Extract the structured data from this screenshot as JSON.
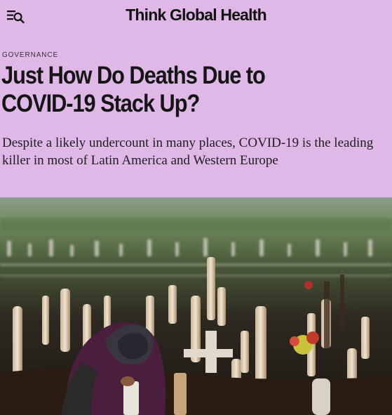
{
  "header": {
    "brand": "Think Global Health",
    "menu_icon": "menu-search-icon"
  },
  "article": {
    "category": "GOVERNANCE",
    "title": "Just How Do Deaths Due to COVID-19 Stack Up?",
    "dek": "Despite a likely undercount in many places, COVID-19 is the leading killer in most of Latin America and Western Europe"
  },
  "colors": {
    "background": "#dfb8e8",
    "text": "#151515"
  }
}
